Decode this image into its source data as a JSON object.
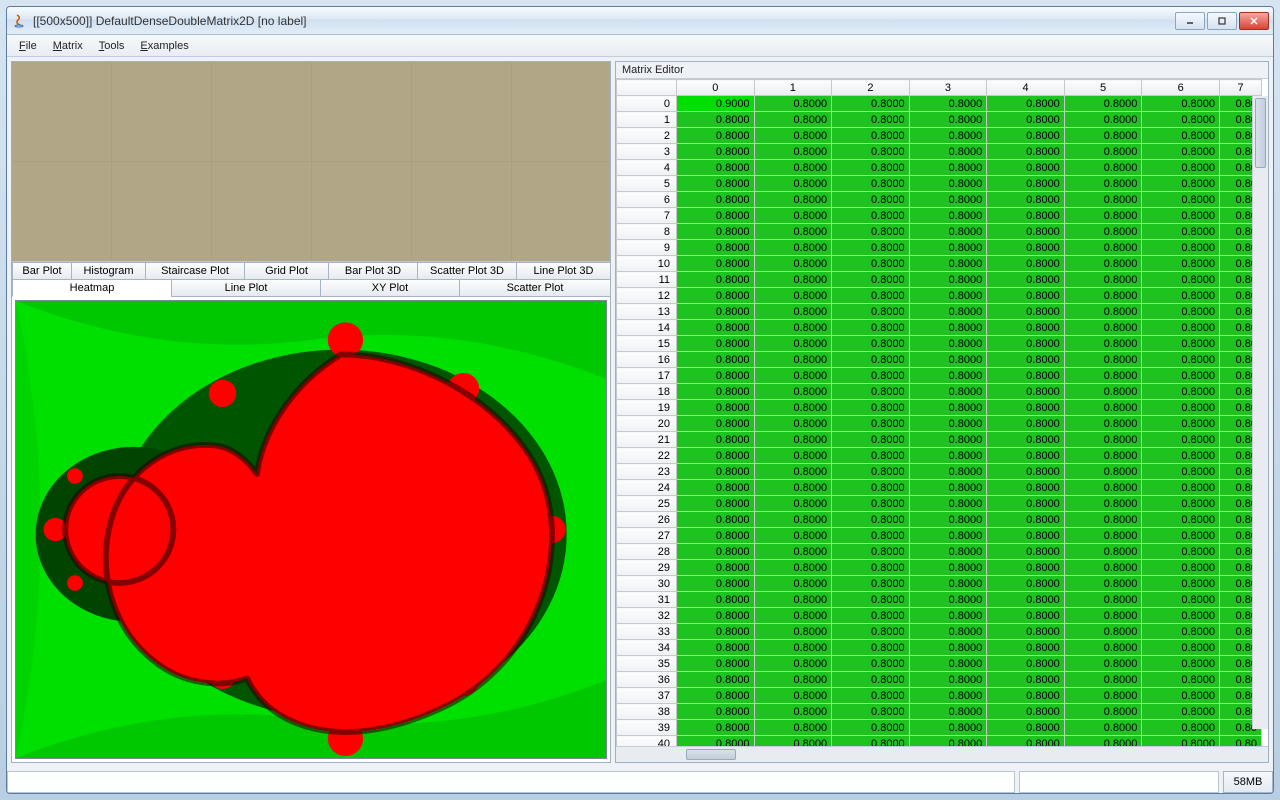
{
  "window": {
    "title": "[[500x500]] DefaultDenseDoubleMatrix2D [no label]"
  },
  "menu": {
    "file": "File",
    "matrix": "Matrix",
    "tools": "Tools",
    "examples": "Examples"
  },
  "tabs": {
    "row1": [
      "Bar Plot",
      "Histogram",
      "Staircase Plot",
      "Grid Plot",
      "Bar Plot 3D",
      "Scatter Plot 3D",
      "Line Plot 3D"
    ],
    "row2": [
      "Heatmap",
      "Line Plot",
      "XY Plot",
      "Scatter Plot"
    ],
    "active": "Heatmap"
  },
  "editor": {
    "title": "Matrix Editor",
    "col_headers": [
      "0",
      "1",
      "2",
      "3",
      "4",
      "5",
      "6",
      "7"
    ],
    "row_count": 41,
    "first_cell_value": "0.9000",
    "cell_value": "0.8000",
    "last_col_value": "0.80"
  },
  "status": {
    "memory": "58MB"
  },
  "chart_data": {
    "type": "heatmap",
    "description": "Mandelbrot-set fractal rendered as heatmap; interior points red, exterior gradient green-to-black near boundary",
    "matrix_shape": [
      500,
      500
    ],
    "value_range": [
      0.0,
      1.0
    ],
    "sample_values_top_left": [
      [
        0.9,
        0.8,
        0.8,
        0.8,
        0.8,
        0.8,
        0.8,
        0.8
      ]
    ],
    "colormap": {
      "low": "#00ff00",
      "boundary": "#003300",
      "interior": "#ff0000"
    }
  }
}
